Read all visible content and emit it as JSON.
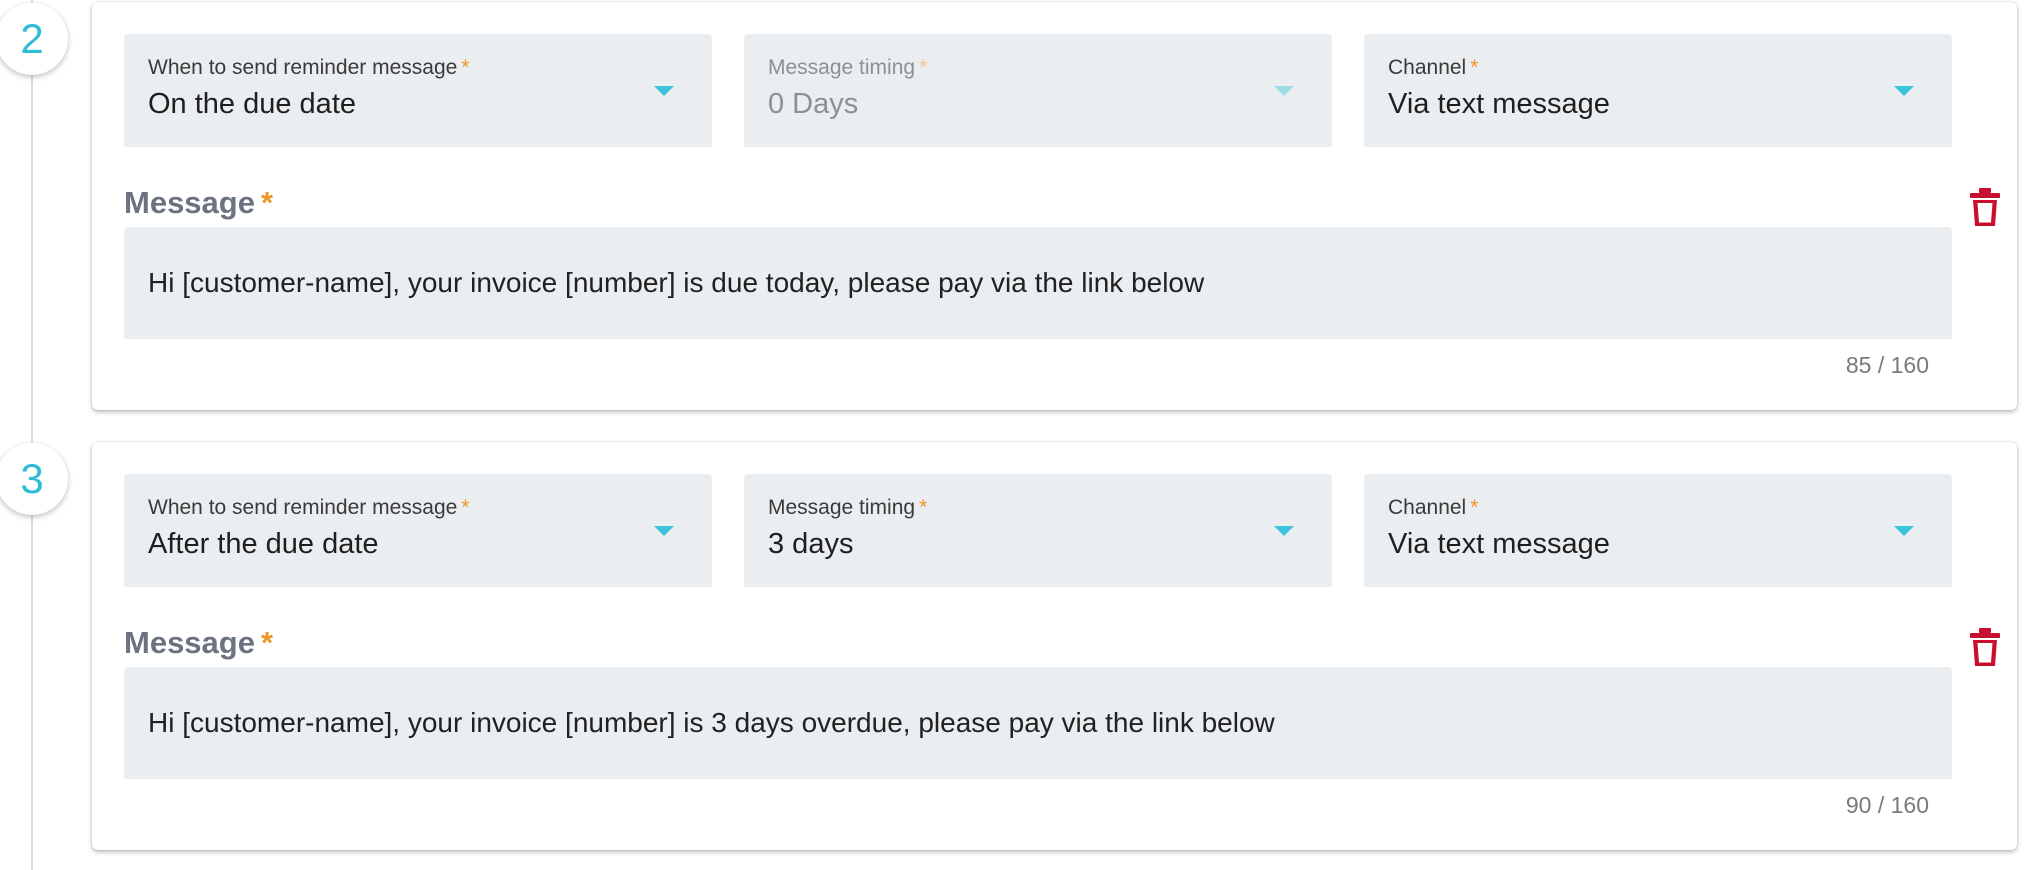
{
  "steps": [
    {
      "number": "2",
      "when": {
        "label": "When to send reminder message",
        "required": "*",
        "value": "On the due date"
      },
      "timing": {
        "label": "Message timing",
        "required": "*",
        "value": "0 Days",
        "disabled": true
      },
      "channel": {
        "label": "Channel",
        "required": "*",
        "value": "Via text message"
      },
      "message": {
        "label": "Message",
        "required": "*",
        "text": "Hi [customer-name], your invoice [number] is due today, please pay via the link below",
        "counter": "85 / 160"
      }
    },
    {
      "number": "3",
      "when": {
        "label": "When to send reminder message",
        "required": "*",
        "value": "After the due date"
      },
      "timing": {
        "label": "Message timing",
        "required": "*",
        "value": "3 days",
        "disabled": false
      },
      "channel": {
        "label": "Channel",
        "required": "*",
        "value": "Via text message"
      },
      "message": {
        "label": "Message",
        "required": "*",
        "text": "Hi [customer-name], your invoice [number] is 3 days overdue, please pay via the link below",
        "counter": "90 / 160"
      }
    }
  ],
  "colors": {
    "accent": "#2fbbd6",
    "required": "#f0962b",
    "delete": "#c8102e",
    "field_bg": "#eaeef1"
  },
  "icons": {
    "delete": "trash-icon",
    "dropdown": "caret-down-icon"
  }
}
